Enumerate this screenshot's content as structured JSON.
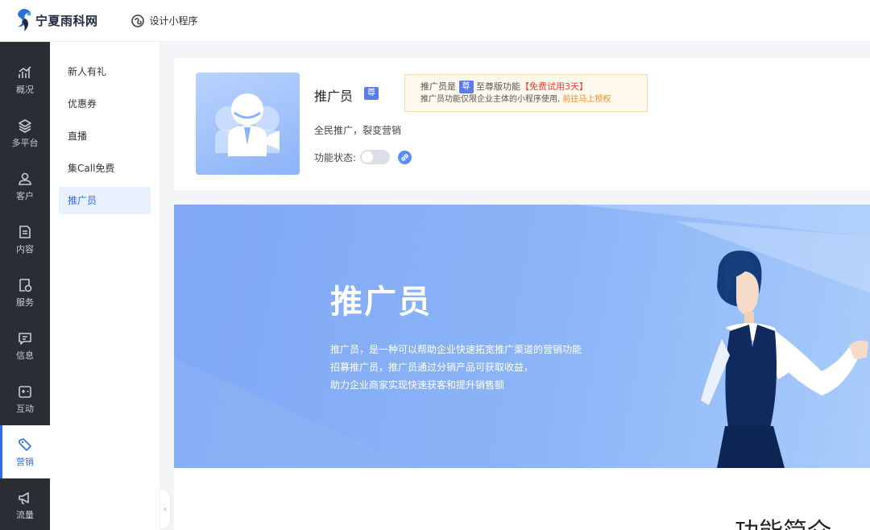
{
  "header": {
    "logo_text": "宁夏雨科网",
    "design_link": "设计小程序"
  },
  "nav": {
    "items": [
      {
        "label": "概况",
        "icon": "chart-icon"
      },
      {
        "label": "多平台",
        "icon": "layers-icon"
      },
      {
        "label": "客户",
        "icon": "user-icon"
      },
      {
        "label": "内容",
        "icon": "document-icon"
      },
      {
        "label": "服务",
        "icon": "service-icon"
      },
      {
        "label": "信息",
        "icon": "message-icon"
      },
      {
        "label": "互动",
        "icon": "gamepad-icon"
      },
      {
        "label": "营销",
        "icon": "tag-icon"
      },
      {
        "label": "流量",
        "icon": "megaphone-icon"
      }
    ],
    "active": "营销"
  },
  "subnav": {
    "items": [
      "新人有礼",
      "优惠券",
      "直播",
      "集Call免费",
      "推广员"
    ],
    "active": "推广员"
  },
  "feature": {
    "title": "推广员",
    "badge": "尊",
    "notice_line1_a": "推广员是",
    "notice_line1_b": "至尊版功能",
    "notice_line1_trial": "【免费试用3天】",
    "notice_line2_a": "推广员功能仅限企业主体的小程序使用,",
    "notice_line2_link": "前往马上授权",
    "slogan": "全民推广，裂变营销",
    "status_label": "功能状态:",
    "status_enabled": false
  },
  "banner": {
    "title": "推广员",
    "desc": [
      "推广员，是一种可以帮助企业快速拓宽推广渠道的营销功能",
      "招募推广员，推广员通过分销产品可获取收益，",
      "助力企业商家实现快速获客和提升销售额"
    ]
  },
  "section": {
    "title": "功能简介"
  },
  "colors": {
    "accent": "#2b6cf2",
    "nav_bg": "#2a2d34",
    "banner_bg": "#8cb4f7",
    "trial_red": "#f23b2f",
    "link_orange": "#f08a24"
  }
}
